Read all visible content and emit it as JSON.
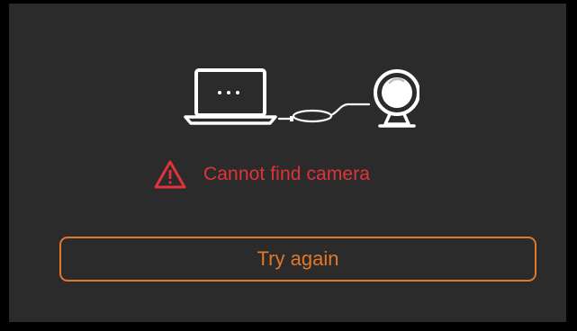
{
  "illustration": {
    "left_icon": "laptop-icon",
    "right_icon": "webcam-icon",
    "connector": "cable-icon"
  },
  "error": {
    "icon": "warning-triangle-icon",
    "message": "Cannot find camera"
  },
  "actions": {
    "retry_label": "Try again"
  },
  "colors": {
    "background": "#2b2b2b",
    "frame": "#000000",
    "error": "#e0333a",
    "accent": "#e2772a",
    "line_art": "#ffffff"
  }
}
